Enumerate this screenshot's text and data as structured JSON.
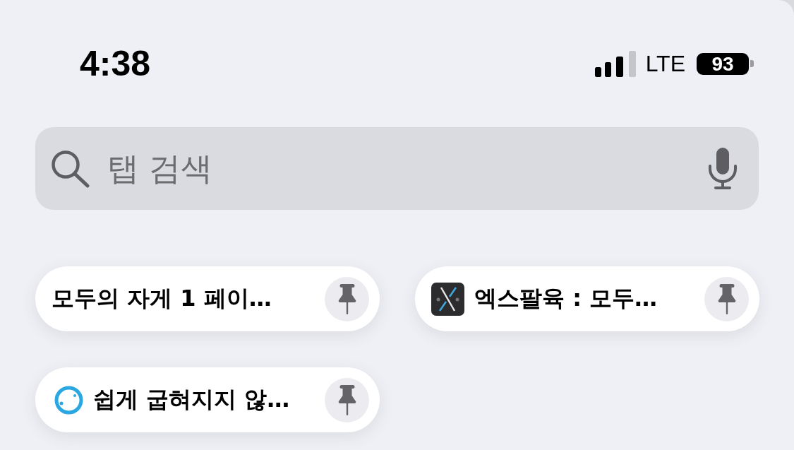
{
  "status_bar": {
    "time": "4:38",
    "network": "LTE",
    "battery": "93"
  },
  "search": {
    "placeholder": "탭 검색"
  },
  "pinned_tabs": [
    {
      "kind": "plain",
      "title": "모두의 자게 1 페이…"
    },
    {
      "kind": "tile",
      "title": "엑스팔육 : 모두…"
    },
    {
      "kind": "ring",
      "title": "쉽게 굽혀지지 않…"
    }
  ]
}
